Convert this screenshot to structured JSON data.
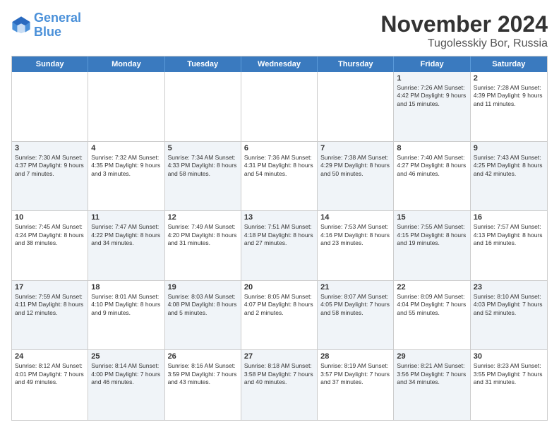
{
  "logo": {
    "line1": "General",
    "line2": "Blue"
  },
  "title": "November 2024",
  "subtitle": "Tugolesskiy Bor, Russia",
  "dayNames": [
    "Sunday",
    "Monday",
    "Tuesday",
    "Wednesday",
    "Thursday",
    "Friday",
    "Saturday"
  ],
  "weeks": [
    [
      {
        "date": "",
        "info": "",
        "shaded": false,
        "empty": true
      },
      {
        "date": "",
        "info": "",
        "shaded": false,
        "empty": true
      },
      {
        "date": "",
        "info": "",
        "shaded": false,
        "empty": true
      },
      {
        "date": "",
        "info": "",
        "shaded": false,
        "empty": true
      },
      {
        "date": "",
        "info": "",
        "shaded": false,
        "empty": true
      },
      {
        "date": "1",
        "info": "Sunrise: 7:26 AM\nSunset: 4:42 PM\nDaylight: 9 hours and 15 minutes.",
        "shaded": true,
        "empty": false
      },
      {
        "date": "2",
        "info": "Sunrise: 7:28 AM\nSunset: 4:39 PM\nDaylight: 9 hours and 11 minutes.",
        "shaded": false,
        "empty": false
      }
    ],
    [
      {
        "date": "3",
        "info": "Sunrise: 7:30 AM\nSunset: 4:37 PM\nDaylight: 9 hours and 7 minutes.",
        "shaded": true,
        "empty": false
      },
      {
        "date": "4",
        "info": "Sunrise: 7:32 AM\nSunset: 4:35 PM\nDaylight: 9 hours and 3 minutes.",
        "shaded": false,
        "empty": false
      },
      {
        "date": "5",
        "info": "Sunrise: 7:34 AM\nSunset: 4:33 PM\nDaylight: 8 hours and 58 minutes.",
        "shaded": true,
        "empty": false
      },
      {
        "date": "6",
        "info": "Sunrise: 7:36 AM\nSunset: 4:31 PM\nDaylight: 8 hours and 54 minutes.",
        "shaded": false,
        "empty": false
      },
      {
        "date": "7",
        "info": "Sunrise: 7:38 AM\nSunset: 4:29 PM\nDaylight: 8 hours and 50 minutes.",
        "shaded": true,
        "empty": false
      },
      {
        "date": "8",
        "info": "Sunrise: 7:40 AM\nSunset: 4:27 PM\nDaylight: 8 hours and 46 minutes.",
        "shaded": false,
        "empty": false
      },
      {
        "date": "9",
        "info": "Sunrise: 7:43 AM\nSunset: 4:25 PM\nDaylight: 8 hours and 42 minutes.",
        "shaded": true,
        "empty": false
      }
    ],
    [
      {
        "date": "10",
        "info": "Sunrise: 7:45 AM\nSunset: 4:24 PM\nDaylight: 8 hours and 38 minutes.",
        "shaded": false,
        "empty": false
      },
      {
        "date": "11",
        "info": "Sunrise: 7:47 AM\nSunset: 4:22 PM\nDaylight: 8 hours and 34 minutes.",
        "shaded": true,
        "empty": false
      },
      {
        "date": "12",
        "info": "Sunrise: 7:49 AM\nSunset: 4:20 PM\nDaylight: 8 hours and 31 minutes.",
        "shaded": false,
        "empty": false
      },
      {
        "date": "13",
        "info": "Sunrise: 7:51 AM\nSunset: 4:18 PM\nDaylight: 8 hours and 27 minutes.",
        "shaded": true,
        "empty": false
      },
      {
        "date": "14",
        "info": "Sunrise: 7:53 AM\nSunset: 4:16 PM\nDaylight: 8 hours and 23 minutes.",
        "shaded": false,
        "empty": false
      },
      {
        "date": "15",
        "info": "Sunrise: 7:55 AM\nSunset: 4:15 PM\nDaylight: 8 hours and 19 minutes.",
        "shaded": true,
        "empty": false
      },
      {
        "date": "16",
        "info": "Sunrise: 7:57 AM\nSunset: 4:13 PM\nDaylight: 8 hours and 16 minutes.",
        "shaded": false,
        "empty": false
      }
    ],
    [
      {
        "date": "17",
        "info": "Sunrise: 7:59 AM\nSunset: 4:11 PM\nDaylight: 8 hours and 12 minutes.",
        "shaded": true,
        "empty": false
      },
      {
        "date": "18",
        "info": "Sunrise: 8:01 AM\nSunset: 4:10 PM\nDaylight: 8 hours and 9 minutes.",
        "shaded": false,
        "empty": false
      },
      {
        "date": "19",
        "info": "Sunrise: 8:03 AM\nSunset: 4:08 PM\nDaylight: 8 hours and 5 minutes.",
        "shaded": true,
        "empty": false
      },
      {
        "date": "20",
        "info": "Sunrise: 8:05 AM\nSunset: 4:07 PM\nDaylight: 8 hours and 2 minutes.",
        "shaded": false,
        "empty": false
      },
      {
        "date": "21",
        "info": "Sunrise: 8:07 AM\nSunset: 4:05 PM\nDaylight: 7 hours and 58 minutes.",
        "shaded": true,
        "empty": false
      },
      {
        "date": "22",
        "info": "Sunrise: 8:09 AM\nSunset: 4:04 PM\nDaylight: 7 hours and 55 minutes.",
        "shaded": false,
        "empty": false
      },
      {
        "date": "23",
        "info": "Sunrise: 8:10 AM\nSunset: 4:03 PM\nDaylight: 7 hours and 52 minutes.",
        "shaded": true,
        "empty": false
      }
    ],
    [
      {
        "date": "24",
        "info": "Sunrise: 8:12 AM\nSunset: 4:01 PM\nDaylight: 7 hours and 49 minutes.",
        "shaded": false,
        "empty": false
      },
      {
        "date": "25",
        "info": "Sunrise: 8:14 AM\nSunset: 4:00 PM\nDaylight: 7 hours and 46 minutes.",
        "shaded": true,
        "empty": false
      },
      {
        "date": "26",
        "info": "Sunrise: 8:16 AM\nSunset: 3:59 PM\nDaylight: 7 hours and 43 minutes.",
        "shaded": false,
        "empty": false
      },
      {
        "date": "27",
        "info": "Sunrise: 8:18 AM\nSunset: 3:58 PM\nDaylight: 7 hours and 40 minutes.",
        "shaded": true,
        "empty": false
      },
      {
        "date": "28",
        "info": "Sunrise: 8:19 AM\nSunset: 3:57 PM\nDaylight: 7 hours and 37 minutes.",
        "shaded": false,
        "empty": false
      },
      {
        "date": "29",
        "info": "Sunrise: 8:21 AM\nSunset: 3:56 PM\nDaylight: 7 hours and 34 minutes.",
        "shaded": true,
        "empty": false
      },
      {
        "date": "30",
        "info": "Sunrise: 8:23 AM\nSunset: 3:55 PM\nDaylight: 7 hours and 31 minutes.",
        "shaded": false,
        "empty": false
      }
    ]
  ]
}
